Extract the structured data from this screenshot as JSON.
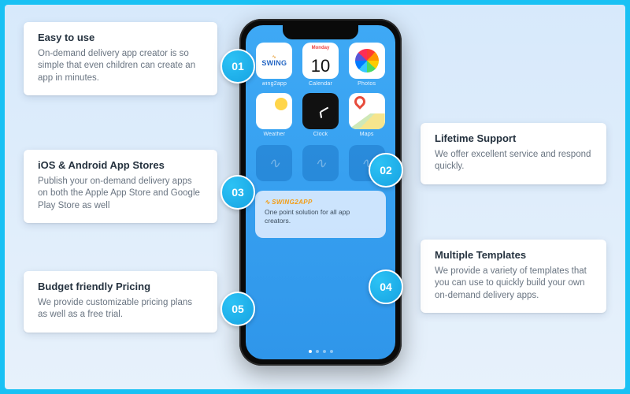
{
  "features": [
    {
      "num": "01",
      "title": "Easy to use",
      "desc": "On-demand delivery app creator is so simple that even children can create an app in minutes."
    },
    {
      "num": "02",
      "title": "Lifetime Support",
      "desc": "We offer excellent service and respond quickly."
    },
    {
      "num": "03",
      "title": "iOS & Android App Stores",
      "desc": "Publish your on-demand delivery apps on both the Apple App Store and Google Play Store as well"
    },
    {
      "num": "04",
      "title": "Multiple Templates",
      "desc": "We provide a variety of templates that you can use to quickly build your own on-demand delivery apps."
    },
    {
      "num": "05",
      "title": "Budget friendly Pricing",
      "desc": "We provide customizable pricing plans as well as a free trial."
    }
  ],
  "phone": {
    "apps": {
      "swing": {
        "label": "wing2app"
      },
      "calendar": {
        "label": "Calendar",
        "weekday": "Monday",
        "day": "10"
      },
      "photos": {
        "label": "Photos"
      },
      "weather": {
        "label": "Weather"
      },
      "clock": {
        "label": "Clock"
      },
      "maps": {
        "label": "Maps"
      }
    },
    "widget": {
      "brand": "SWING2APP",
      "tagline": "One point solution for all app creators."
    }
  }
}
